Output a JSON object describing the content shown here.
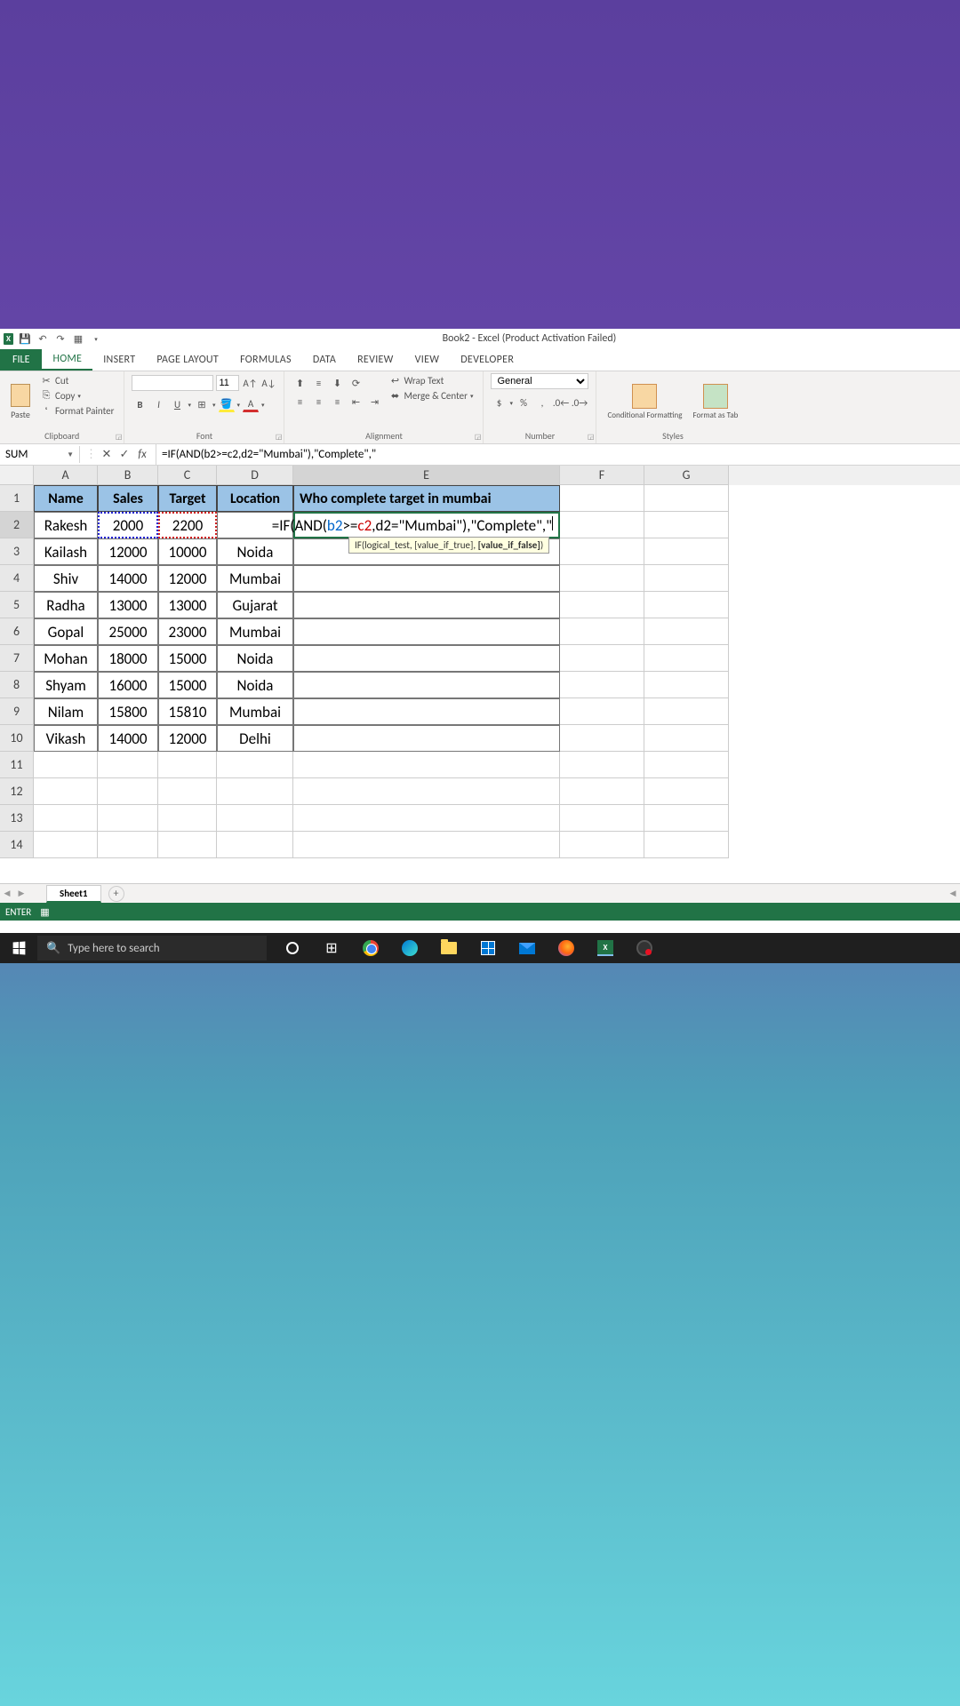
{
  "title": "Book2 - Excel (Product Activation Failed)",
  "tabs": {
    "file": "FILE",
    "home": "HOME",
    "insert": "INSERT",
    "pagelayout": "PAGE LAYOUT",
    "formulas": "FORMULAS",
    "data": "DATA",
    "review": "REVIEW",
    "view": "VIEW",
    "developer": "DEVELOPER"
  },
  "clipboard": {
    "cut": "Cut",
    "copy": "Copy",
    "fp": "Format Painter",
    "paste": "Paste",
    "label": "Clipboard"
  },
  "font": {
    "size": "11",
    "label": "Font"
  },
  "alignment": {
    "wrap": "Wrap Text",
    "merge": "Merge & Center",
    "label": "Alignment"
  },
  "number": {
    "format": "General",
    "label": "Number"
  },
  "styles": {
    "cf": "Conditional Formatting",
    "fa": "Format as Tab",
    "label": "Styles"
  },
  "namebox": "SUM",
  "formula": "=IF(AND(b2>=c2,d2=\"Mumbai\"),\"Complete\",\"",
  "tooltip": "IF(logical_test, [value_if_true], [value_if_false])",
  "cols": [
    "A",
    "B",
    "C",
    "D",
    "E",
    "F",
    "G"
  ],
  "headers": {
    "A": "Name",
    "B": "Sales",
    "C": "Target",
    "D": "Location",
    "E": "Who complete target in mumbai"
  },
  "rows": [
    {
      "n": "2",
      "A": "Rakesh",
      "B": "2000",
      "C": "2200",
      "D": "",
      "E": "=IF(AND(b2>=c2,d2=\"Mumbai\"),\"Complete\",\""
    },
    {
      "n": "3",
      "A": "Kailash",
      "B": "12000",
      "C": "10000",
      "D": "Noida",
      "E": ""
    },
    {
      "n": "4",
      "A": "Shiv",
      "B": "14000",
      "C": "12000",
      "D": "Mumbai",
      "E": ""
    },
    {
      "n": "5",
      "A": "Radha",
      "B": "13000",
      "C": "13000",
      "D": "Gujarat",
      "E": ""
    },
    {
      "n": "6",
      "A": "Gopal",
      "B": "25000",
      "C": "23000",
      "D": "Mumbai",
      "E": ""
    },
    {
      "n": "7",
      "A": "Mohan",
      "B": "18000",
      "C": "15000",
      "D": "Noida",
      "E": ""
    },
    {
      "n": "8",
      "A": "Shyam",
      "B": "16000",
      "C": "15000",
      "D": "Noida",
      "E": ""
    },
    {
      "n": "9",
      "A": "Nilam",
      "B": "15800",
      "C": "15810",
      "D": "Mumbai",
      "E": ""
    },
    {
      "n": "10",
      "A": "Vikash",
      "B": "14000",
      "C": "12000",
      "D": "Delhi",
      "E": ""
    }
  ],
  "emptyrows": [
    "11",
    "12",
    "13",
    "14"
  ],
  "sheet": "Sheet1",
  "status": "ENTER",
  "search": "Type here to search"
}
